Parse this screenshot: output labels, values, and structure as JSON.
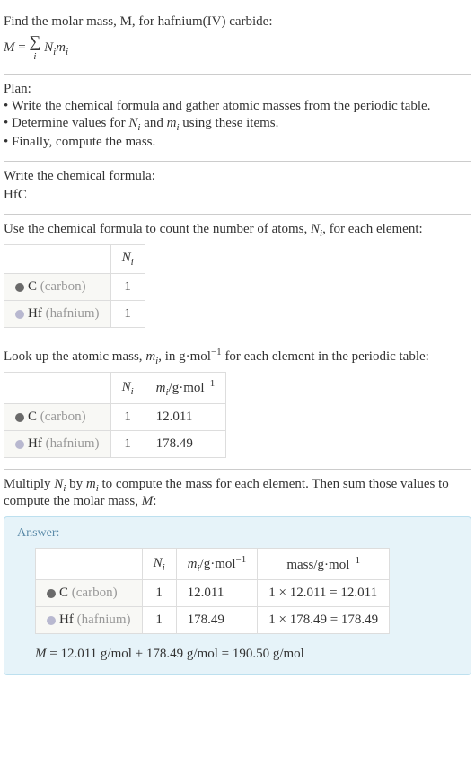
{
  "intro": {
    "prompt": "Find the molar mass, M, for hafnium(IV) carbide:",
    "formula_lhs": "M",
    "formula_eq": "=",
    "formula_sum": "∑",
    "formula_sub": "i",
    "formula_rhs_n": "N",
    "formula_rhs_m": "m"
  },
  "plan": {
    "title": "Plan:",
    "line1": "• Write the chemical formula and gather atomic masses from the periodic table.",
    "line2_a": "• Determine values for ",
    "line2_n": "N",
    "line2_and": " and ",
    "line2_m": "m",
    "line2_b": " using these items.",
    "line3": "• Finally, compute the mass."
  },
  "chemical": {
    "prompt": "Write the chemical formula:",
    "formula": "HfC"
  },
  "count_atoms": {
    "prompt_a": "Use the chemical formula to count the number of atoms, ",
    "prompt_n": "N",
    "prompt_b": ", for each element:",
    "header_n": "N",
    "row1_el_sym": "C",
    "row1_el_name": " (carbon)",
    "row1_n": "1",
    "row2_el_sym": "Hf",
    "row2_el_name": " (hafnium)",
    "row2_n": "1"
  },
  "atomic_mass": {
    "prompt_a": "Look up the atomic mass, ",
    "prompt_m": "m",
    "prompt_b": ", in g·mol",
    "prompt_exp": "−1",
    "prompt_c": " for each element in the periodic table:",
    "header_n": "N",
    "header_m": "m",
    "header_unit_a": "/g·mol",
    "header_unit_exp": "−1",
    "row1_el_sym": "C",
    "row1_el_name": " (carbon)",
    "row1_n": "1",
    "row1_m": "12.011",
    "row2_el_sym": "Hf",
    "row2_el_name": " (hafnium)",
    "row2_n": "1",
    "row2_m": "178.49"
  },
  "multiply": {
    "prompt_a": "Multiply ",
    "prompt_n": "N",
    "prompt_b": " by ",
    "prompt_m": "m",
    "prompt_c": " to compute the mass for each element. Then sum those values to compute the molar mass, ",
    "prompt_M": "M",
    "prompt_d": ":"
  },
  "answer": {
    "label": "Answer:",
    "header_n": "N",
    "header_m": "m",
    "header_unit_a": "/g·mol",
    "header_unit_exp": "−1",
    "header_mass": "mass/g·mol",
    "header_mass_exp": "−1",
    "row1_el_sym": "C",
    "row1_el_name": " (carbon)",
    "row1_n": "1",
    "row1_m": "12.011",
    "row1_mass": "1 × 12.011 = 12.011",
    "row2_el_sym": "Hf",
    "row2_el_name": " (hafnium)",
    "row2_n": "1",
    "row2_m": "178.49",
    "row2_mass": "1 × 178.49 = 178.49",
    "final_M": "M",
    "final_eq": " = 12.011 g/mol + 178.49 g/mol = 190.50 g/mol"
  }
}
